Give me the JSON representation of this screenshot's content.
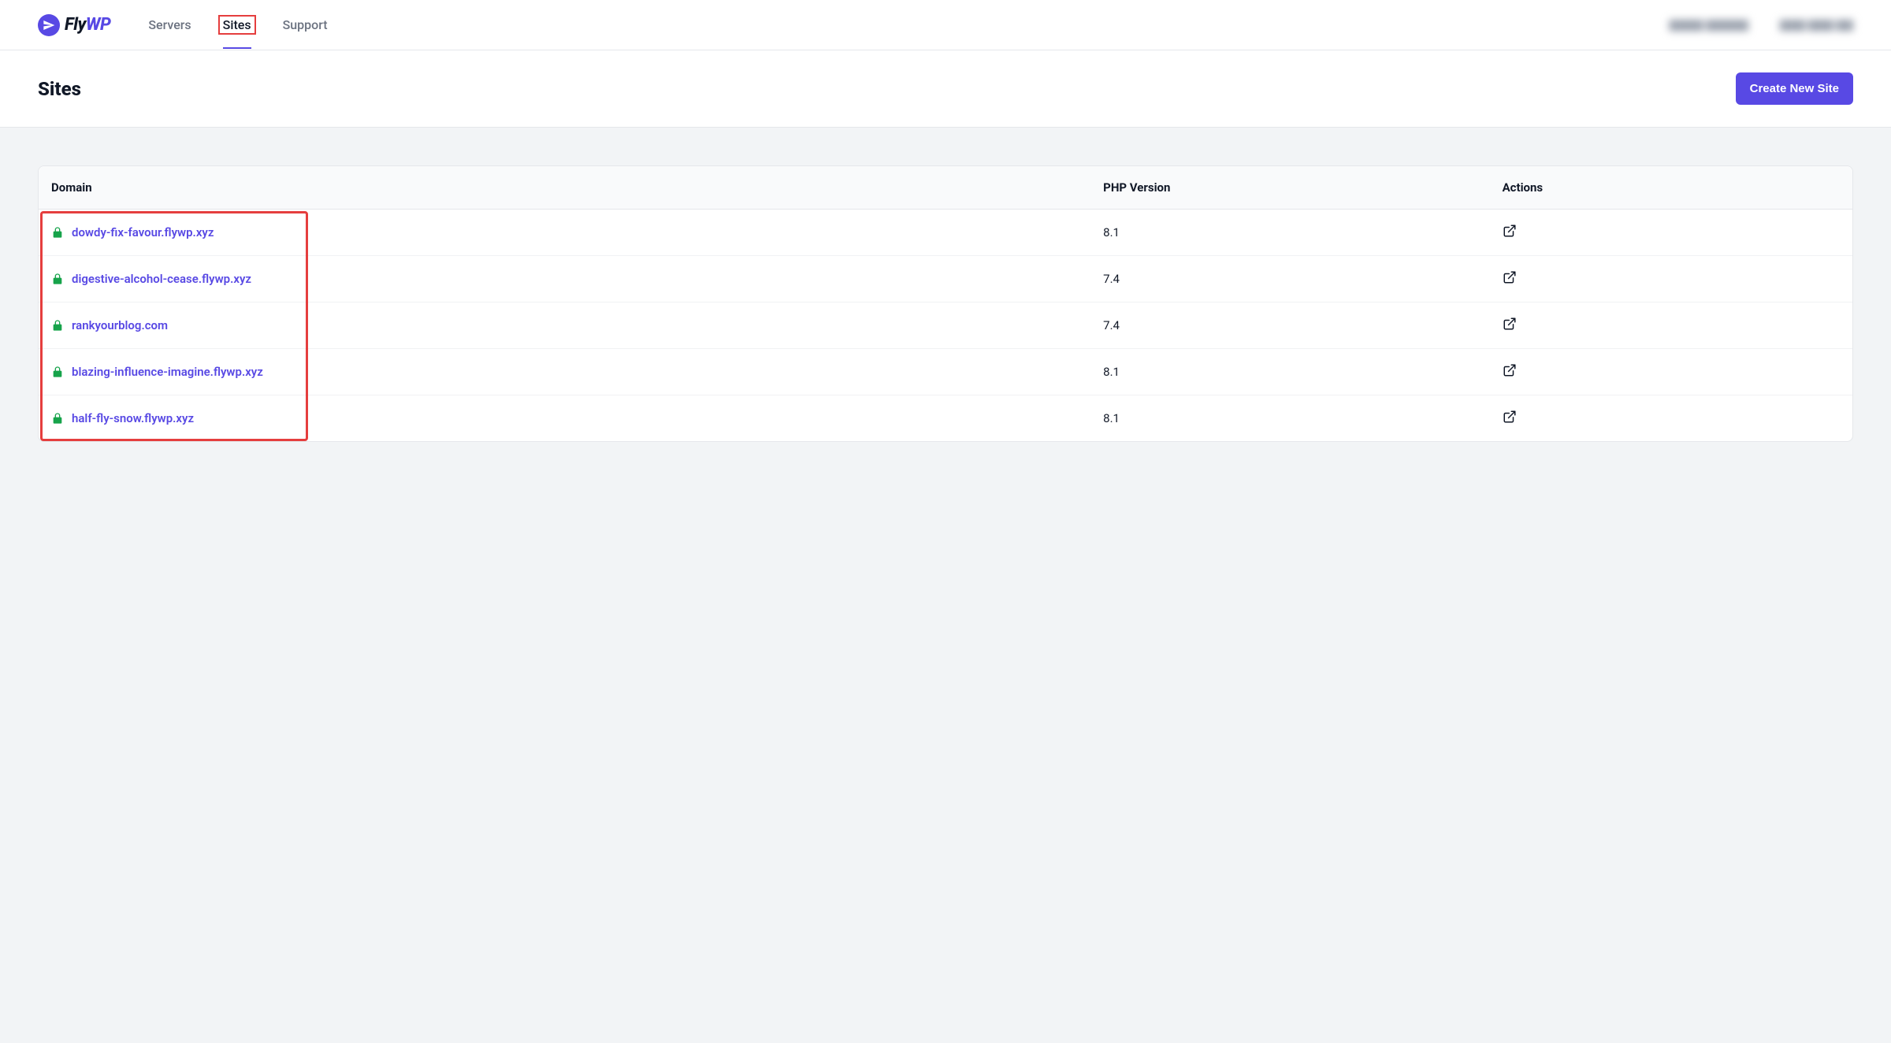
{
  "brand": {
    "name_fly": "Fly",
    "name_wp": "WP"
  },
  "nav": {
    "items": [
      {
        "label": "Servers",
        "active": false
      },
      {
        "label": "Sites",
        "active": true
      },
      {
        "label": "Support",
        "active": false
      }
    ]
  },
  "header": {
    "title": "Sites",
    "create_button": "Create New Site"
  },
  "table": {
    "columns": {
      "domain": "Domain",
      "php": "PHP Version",
      "actions": "Actions"
    },
    "rows": [
      {
        "domain": "dowdy-fix-favour.flywp.xyz",
        "php": "8.1"
      },
      {
        "domain": "digestive-alcohol-cease.flywp.xyz",
        "php": "7.4"
      },
      {
        "domain": "rankyourblog.com",
        "php": "7.4"
      },
      {
        "domain": "blazing-influence-imagine.flywp.xyz",
        "php": "8.1"
      },
      {
        "domain": "half-fly-snow.flywp.xyz",
        "php": "8.1"
      }
    ]
  }
}
